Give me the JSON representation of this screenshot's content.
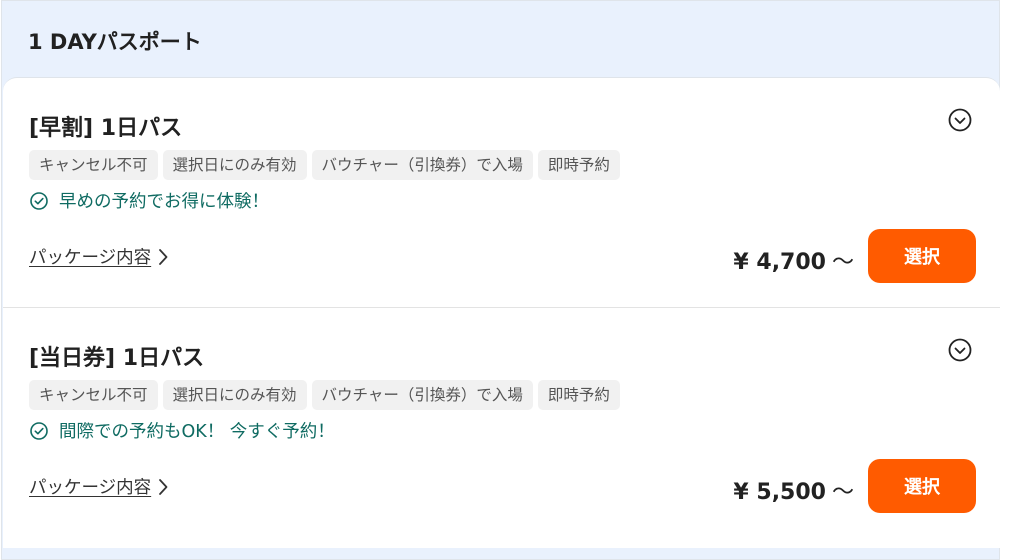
{
  "panel": {
    "title": "1 DAYパスポート"
  },
  "colors": {
    "accent": "#ff5b00",
    "benefit": "#0f6b62",
    "panel_bg": "#e9f1fd"
  },
  "cards": [
    {
      "title": "[早割] 1日パス",
      "tags": [
        "キャンセル不可",
        "選択日にのみ有効",
        "バウチャー（引換券）で入場",
        "即時予約"
      ],
      "benefit": "早めの予約でお得に体験！",
      "package_link": "パッケージ内容",
      "price": "¥ 4,700",
      "price_suffix": "〜",
      "select_label": "選択"
    },
    {
      "title": "[当日券] 1日パス",
      "tags": [
        "キャンセル不可",
        "選択日にのみ有効",
        "バウチャー（引換券）で入場",
        "即時予約"
      ],
      "benefit": "間際での予約もOK！ 今すぐ予約！",
      "package_link": "パッケージ内容",
      "price": "¥ 5,500",
      "price_suffix": "〜",
      "select_label": "選択"
    }
  ]
}
